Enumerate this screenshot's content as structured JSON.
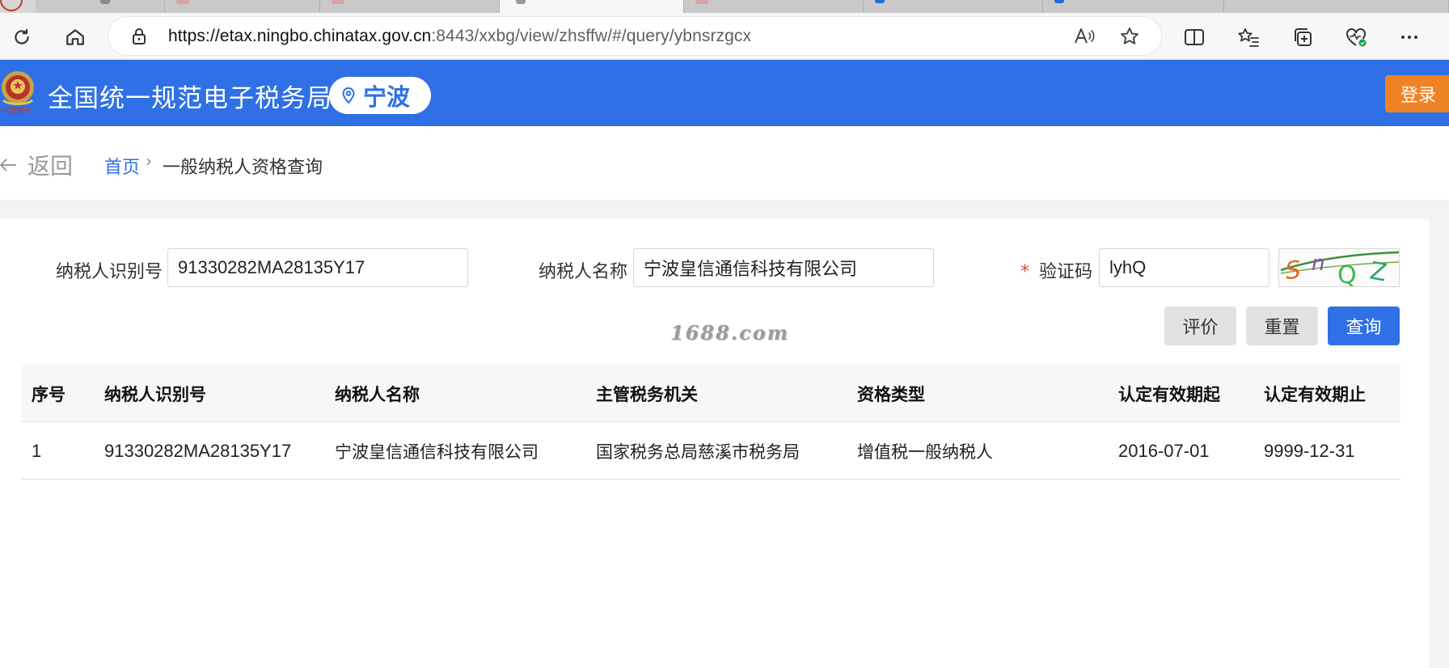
{
  "browser": {
    "url_host": "https://etax.ningbo.chinatax.gov.cn",
    "url_rest": ":8443/xxbg/view/zhsffw/#/query/ybnsrzgcx"
  },
  "header": {
    "site_title": "全国统一规范电子税务局",
    "city": "宁波",
    "login_label": "登录",
    "brand_color": "#2f70e6",
    "login_color": "#ee8325"
  },
  "breadcrumb": {
    "back_label": "返回",
    "home": "首页",
    "separator": "›",
    "current": "一般纳税人资格查询"
  },
  "form": {
    "taxpayer_id_label": "纳税人识别号",
    "taxpayer_id_value": "91330282MA28135Y17",
    "taxpayer_name_label": "纳税人名称",
    "taxpayer_name_value": "宁波皇信通信科技有限公司",
    "captcha_required_mark": "*",
    "captcha_label": "验证码",
    "captcha_value": "lyhQ",
    "captcha_image_text": "SnQZ",
    "buttons": {
      "evaluate": "评价",
      "reset": "重置",
      "query": "查询"
    }
  },
  "watermark": "1688.com",
  "table": {
    "headers": [
      "序号",
      "纳税人识别号",
      "纳税人名称",
      "主管税务机关",
      "资格类型",
      "认定有效期起",
      "认定有效期止"
    ],
    "rows": [
      [
        "1",
        "91330282MA28135Y17",
        "宁波皇信通信科技有限公司",
        "国家税务总局慈溪市税务局",
        "增值税一般纳税人",
        "2016-07-01",
        "9999-12-31"
      ]
    ]
  }
}
